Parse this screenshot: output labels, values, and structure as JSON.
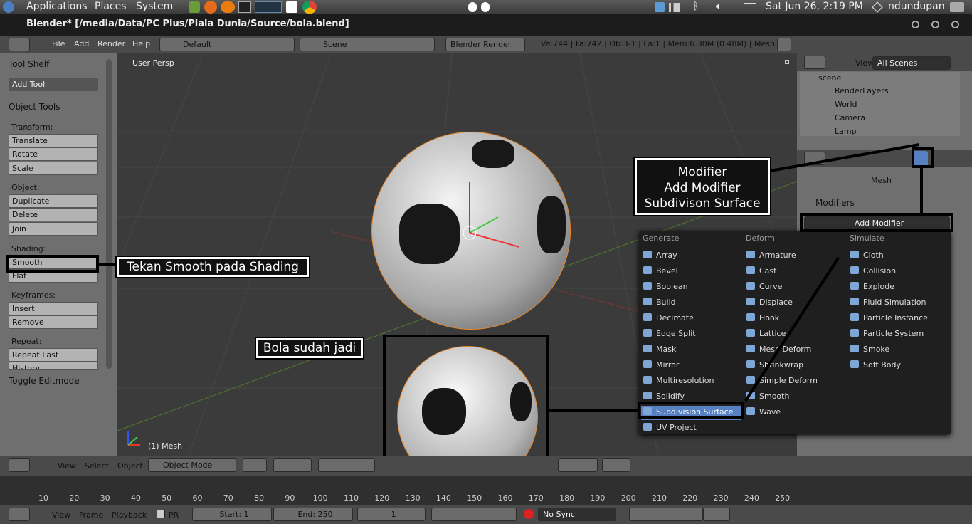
{
  "system_bar": {
    "menus": [
      "Applications",
      "Places",
      "System"
    ],
    "clock": "Sat Jun 26,  2:19 PM",
    "user": "ndundupan"
  },
  "window": {
    "title": "Blender* [/media/Data/PC Plus/Piala Dunia/Source/bola.blend]"
  },
  "info_header": {
    "menus": [
      "File",
      "Add",
      "Render",
      "Help"
    ],
    "layout": "Default",
    "scene": "Scene",
    "engine": "Blender Render",
    "stats": "Ve:744 | Fa:742 | Ob:3-1 | La:1 | Mem:6.30M (0.48M) | Mesh"
  },
  "tool_shelf": {
    "title": "Tool Shelf",
    "add_tool": "Add Tool",
    "object_tools": "Object Tools",
    "transform_label": "Transform:",
    "transform": [
      "Translate",
      "Rotate",
      "Scale"
    ],
    "object_label": "Object:",
    "object": [
      "Duplicate",
      "Delete",
      "Join"
    ],
    "shading_label": "Shading:",
    "shading": [
      "Smooth",
      "Flat"
    ],
    "keyframes_label": "Keyframes:",
    "keyframes": [
      "Insert",
      "Remove"
    ],
    "repeat_label": "Repeat:",
    "repeat": [
      "Repeat Last",
      "History..."
    ],
    "toggle": "Toggle Editmode"
  },
  "viewport": {
    "view_label": "User Persp",
    "object_label": "(1) Mesh"
  },
  "outliner": {
    "view": "View",
    "scenes": "All Scenes",
    "items": [
      "scene",
      "RenderLayers",
      "World",
      "Camera",
      "Lamp"
    ]
  },
  "properties": {
    "context": "Mesh",
    "modifiers_title": "Modifiers",
    "add_modifier": "Add Modifier"
  },
  "modifier_menu": {
    "headers": [
      "Generate",
      "Deform",
      "Simulate"
    ],
    "generate": [
      "Array",
      "Bevel",
      "Boolean",
      "Build",
      "Decimate",
      "Edge Split",
      "Mask",
      "Mirror",
      "Multiresolution",
      "Solidify",
      "Subdivision Surface",
      "UV Project"
    ],
    "deform": [
      "Armature",
      "Cast",
      "Curve",
      "Displace",
      "Hook",
      "Lattice",
      "Mesh Deform",
      "Shrinkwrap",
      "Simple Deform",
      "Smooth",
      "Wave"
    ],
    "simulate": [
      "Cloth",
      "Collision",
      "Explode",
      "Fluid Simulation",
      "Particle Instance",
      "Particle System",
      "Smoke",
      "Soft Body"
    ],
    "highlighted": "Subdivision Surface"
  },
  "callouts": {
    "modifier": [
      "Modifier",
      "Add Modifier",
      "Subdivison Surface"
    ],
    "smooth": "Tekan Smooth pada Shading",
    "done": "Bola sudah jadi"
  },
  "view3d_header": {
    "menus": [
      "View",
      "Select",
      "Object"
    ],
    "mode": "Object Mode"
  },
  "timeline": {
    "ticks": [
      "10",
      "20",
      "30",
      "40",
      "50",
      "60",
      "70",
      "80",
      "90",
      "100",
      "110",
      "120",
      "130",
      "140",
      "150",
      "160",
      "170",
      "180",
      "190",
      "200",
      "210",
      "220",
      "230",
      "240",
      "250"
    ],
    "menus": [
      "View",
      "Frame",
      "Playback"
    ],
    "pr": "PR",
    "start": "Start: 1",
    "end": "End: 250",
    "current": "1",
    "sync": "No Sync"
  },
  "colors": {
    "accent": "#5680c2",
    "selection": "#e8892c"
  }
}
